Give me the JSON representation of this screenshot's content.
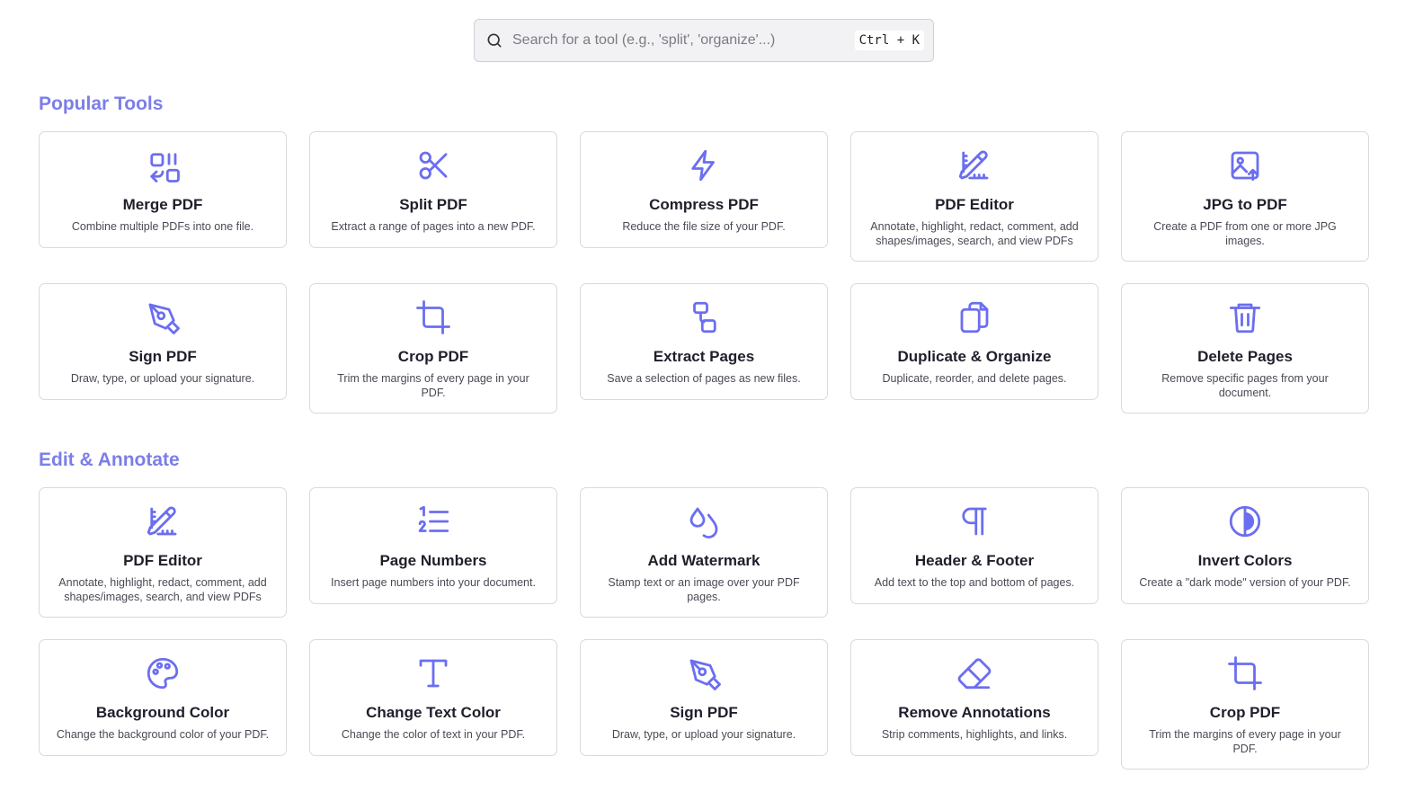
{
  "search": {
    "placeholder": "Search for a tool (e.g., 'split', 'organize'...)",
    "shortcut": "Ctrl + K"
  },
  "colors": {
    "accent": "#6b6ef0",
    "section_title": "#7b7ee8"
  },
  "sections": [
    {
      "title": "Popular Tools",
      "tools": [
        {
          "icon": "merge-icon",
          "title": "Merge PDF",
          "desc": "Combine multiple PDFs into one file."
        },
        {
          "icon": "scissors-icon",
          "title": "Split PDF",
          "desc": "Extract a range of pages into a new PDF."
        },
        {
          "icon": "lightning-icon",
          "title": "Compress PDF",
          "desc": "Reduce the file size of your PDF."
        },
        {
          "icon": "pencil-ruler-icon",
          "title": "PDF Editor",
          "desc": "Annotate, highlight, redact, comment, add shapes/images, search, and view PDFs"
        },
        {
          "icon": "image-upload-icon",
          "title": "JPG to PDF",
          "desc": "Create a PDF from one or more JPG images."
        },
        {
          "icon": "pen-nib-icon",
          "title": "Sign PDF",
          "desc": "Draw, type, or upload your signature."
        },
        {
          "icon": "crop-icon",
          "title": "Crop PDF",
          "desc": "Trim the margins of every page in your PDF."
        },
        {
          "icon": "extract-pages-icon",
          "title": "Extract Pages",
          "desc": "Save a selection of pages as new files."
        },
        {
          "icon": "copy-files-icon",
          "title": "Duplicate & Organize",
          "desc": "Duplicate, reorder, and delete pages."
        },
        {
          "icon": "trash-icon",
          "title": "Delete Pages",
          "desc": "Remove specific pages from your document."
        }
      ]
    },
    {
      "title": "Edit & Annotate",
      "tools": [
        {
          "icon": "pencil-ruler-icon",
          "title": "PDF Editor",
          "desc": "Annotate, highlight, redact, comment, add shapes/images, search, and view PDFs"
        },
        {
          "icon": "numbered-list-icon",
          "title": "Page Numbers",
          "desc": "Insert page numbers into your document."
        },
        {
          "icon": "droplets-icon",
          "title": "Add Watermark",
          "desc": "Stamp text or an image over your PDF pages."
        },
        {
          "icon": "pilcrow-icon",
          "title": "Header & Footer",
          "desc": "Add text to the top and bottom of pages."
        },
        {
          "icon": "contrast-icon",
          "title": "Invert Colors",
          "desc": "Create a \"dark mode\" version of your PDF."
        },
        {
          "icon": "palette-icon",
          "title": "Background Color",
          "desc": "Change the background color of your PDF."
        },
        {
          "icon": "type-icon",
          "title": "Change Text Color",
          "desc": "Change the color of text in your PDF."
        },
        {
          "icon": "pen-nib-icon",
          "title": "Sign PDF",
          "desc": "Draw, type, or upload your signature."
        },
        {
          "icon": "eraser-icon",
          "title": "Remove Annotations",
          "desc": "Strip comments, highlights, and links."
        },
        {
          "icon": "crop-icon",
          "title": "Crop PDF",
          "desc": "Trim the margins of every page in your PDF."
        }
      ]
    }
  ]
}
